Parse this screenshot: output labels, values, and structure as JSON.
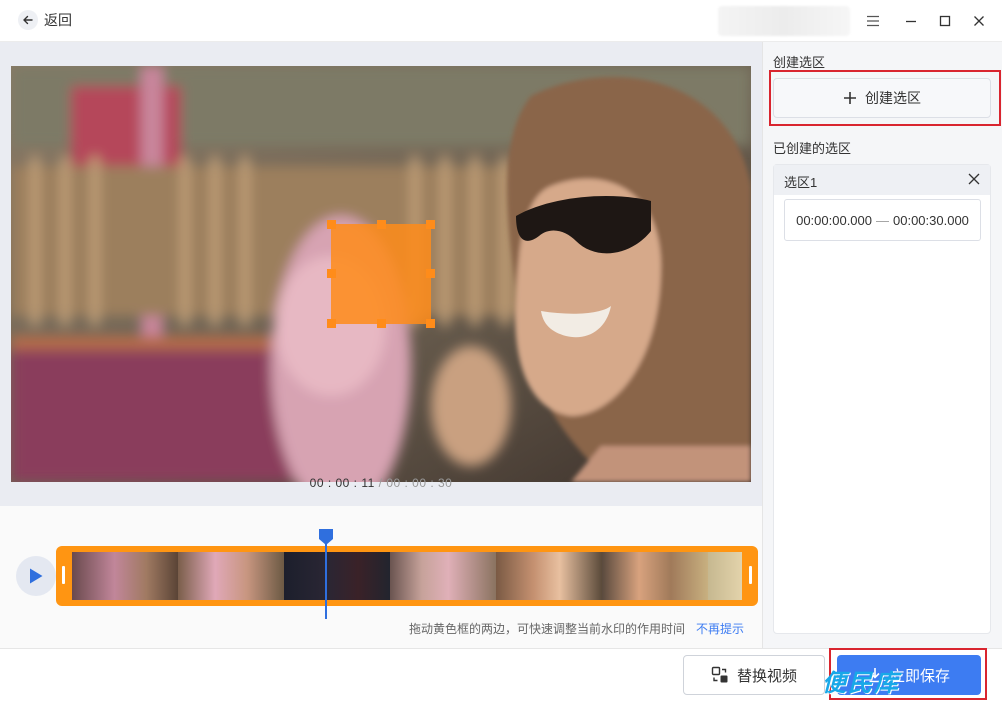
{
  "titlebar": {
    "back_label": "返回"
  },
  "right_panel": {
    "create_title": "创建选区",
    "create_button_label": "创建选区",
    "created_title": "已创建的选区",
    "selections": [
      {
        "name": "选区1",
        "start": "00:00:00.000",
        "end": "00:00:30.000"
      }
    ]
  },
  "timeline": {
    "current_time": "00 : 00 : 11",
    "separator": " / ",
    "total_time": "00 : 00 : 30",
    "hint": "拖动黄色框的两边，可快速调整当前水印的作用时间",
    "hint_link": "不再提示"
  },
  "bottom": {
    "replace_label": "替换视频",
    "save_label": "立即保存",
    "watermark": "便民库"
  },
  "colors": {
    "accent": "#3d7cf2",
    "strip": "#ff9512",
    "highlight": "#d9252f",
    "selection": "#ff8c1a"
  },
  "icons": [
    "back-arrow-icon",
    "menu-icon",
    "minimize-icon",
    "maximize-icon",
    "close-icon",
    "plus-icon",
    "play-icon",
    "replace-icon",
    "download-icon"
  ]
}
